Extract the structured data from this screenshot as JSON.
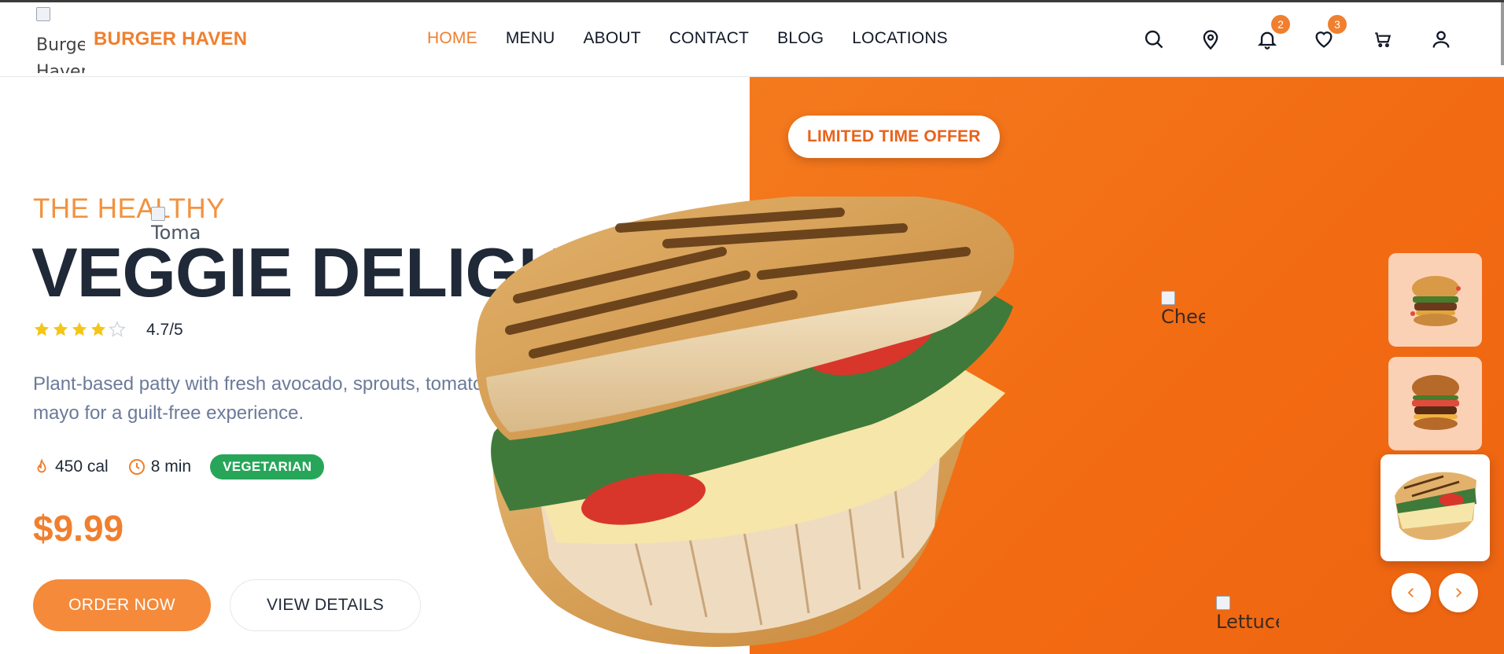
{
  "brand": {
    "logo_alt": "Burger Haven",
    "name": "BURGER HAVEN",
    "accent": "#f07f2e"
  },
  "nav": {
    "items": [
      "HOME",
      "MENU",
      "ABOUT",
      "CONTACT",
      "BLOG",
      "LOCATIONS"
    ],
    "active": "HOME"
  },
  "header_icons": {
    "search": "search-icon",
    "location": "map-pin-icon",
    "notifications": {
      "icon": "bell-icon",
      "count": "2"
    },
    "favorites": {
      "icon": "heart-icon",
      "count": "3"
    },
    "cart": "cart-icon",
    "account": "user-icon"
  },
  "hero": {
    "offer_label": "LIMITED TIME OFFER",
    "eyebrow": "THE HEALTHY",
    "title": "VEGGIE DELIGHT",
    "rating_stars": 4,
    "rating_max": 5,
    "rating_text": "4.7/5",
    "description": "Plant-based patty with fresh avocado, sprouts, tomato, and vegan mayo for a guilt-free experience.",
    "calories": "450 cal",
    "time": "8 min",
    "tag": "VEGETARIAN",
    "price": "$9.99",
    "order_button": "ORDER NOW",
    "details_button": "VIEW DETAILS",
    "bg_color": "#f26a12"
  },
  "floating_images": {
    "tomato_alt": "Tomato",
    "cheese_alt": "Cheese",
    "lettuce_alt": "Lettuce"
  },
  "carousel": {
    "thumbnail_count": 3,
    "active_index": 2
  }
}
